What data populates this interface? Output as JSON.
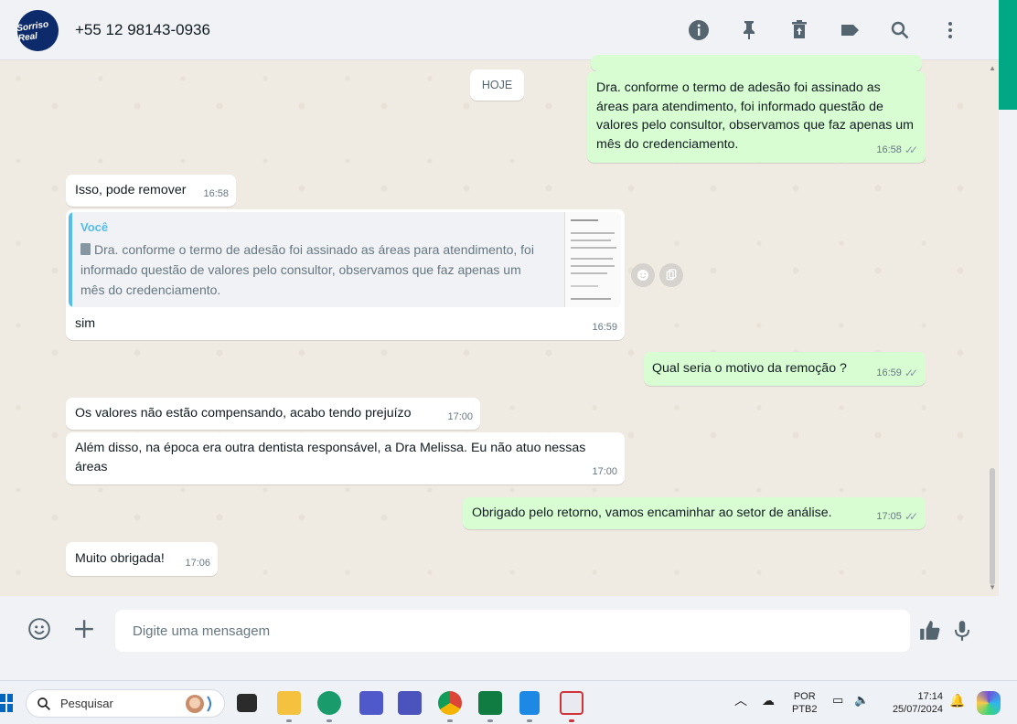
{
  "header": {
    "avatar_text": "Sorriso Real",
    "contact": "+55 12 98143-0936",
    "icons": [
      "info-icon",
      "pin-icon",
      "delete-icon",
      "label-icon",
      "search-icon",
      "more-icon"
    ]
  },
  "chat": {
    "date_chip": "HOJE",
    "messages": [
      {
        "dir": "out",
        "text": "Dra. conforme o termo de adesão foi assinado as áreas para atendimento, foi informado questão de valores pelo consultor, observamos que faz apenas um mês do credenciamento.",
        "time": "16:58",
        "ticks": "✓✓"
      },
      {
        "dir": "in",
        "text": "Isso, pode remover",
        "time": "16:58"
      },
      {
        "dir": "in",
        "quote_author": "Você",
        "quote_text": "Dra. conforme o termo de adesão foi assinado as áreas para atendimento, foi informado questão de valores pelo consultor, observamos que faz apenas um mês do credenciamento.",
        "text": "sim",
        "time": "16:59"
      },
      {
        "dir": "out",
        "text": "Qual seria o motivo da remoção ?",
        "time": "16:59",
        "ticks": "✓✓"
      },
      {
        "dir": "in",
        "text": "Os valores não estão compensando, acabo tendo prejuízo",
        "time": "17:00"
      },
      {
        "dir": "in",
        "text": "Além disso, na época era outra dentista responsável, a Dra Melissa. Eu não atuo nessas áreas",
        "time": "17:00"
      },
      {
        "dir": "out",
        "text": "Obrigado pelo retorno, vamos encaminhar ao setor de análise.",
        "time": "17:05",
        "ticks": "✓✓"
      },
      {
        "dir": "in",
        "text": "Muito obrigada!",
        "time": "17:06"
      }
    ]
  },
  "composer": {
    "placeholder": "Digite uma mensagem",
    "value": ""
  },
  "taskbar": {
    "search_label": "Pesquisar",
    "lang_top": "POR",
    "lang_bottom": "PTB2",
    "time": "17:14",
    "date": "25/07/2024"
  },
  "colors": {
    "accent": "#00a884",
    "out_bubble": "#d9fdd3",
    "in_bubble": "#ffffff",
    "chat_bg": "#efeae2",
    "quote_bar": "#53bdeb"
  }
}
